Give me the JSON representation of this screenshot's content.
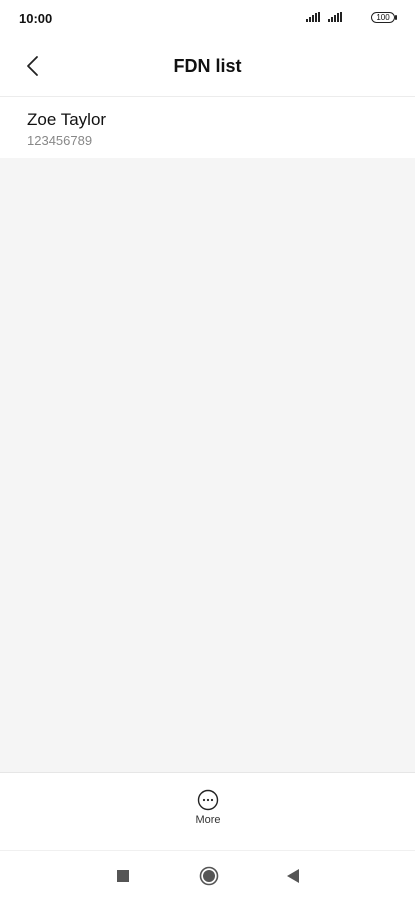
{
  "status_bar": {
    "time": "10:00",
    "battery_level": "100"
  },
  "header": {
    "title": "FDN list",
    "back_icon": "chevron-left-icon"
  },
  "contacts": [
    {
      "name": "Zoe Taylor",
      "number": "123456789"
    }
  ],
  "bottom_bar": {
    "more_label": "More",
    "more_icon": "more-horizontal-circle-icon"
  },
  "nav_bar": {
    "recent_icon": "square-icon",
    "home_icon": "circle-icon",
    "back_icon": "triangle-back-icon"
  },
  "colors": {
    "background": "#ffffff",
    "content_background": "#f5f5f5",
    "secondary_text": "#888888"
  }
}
